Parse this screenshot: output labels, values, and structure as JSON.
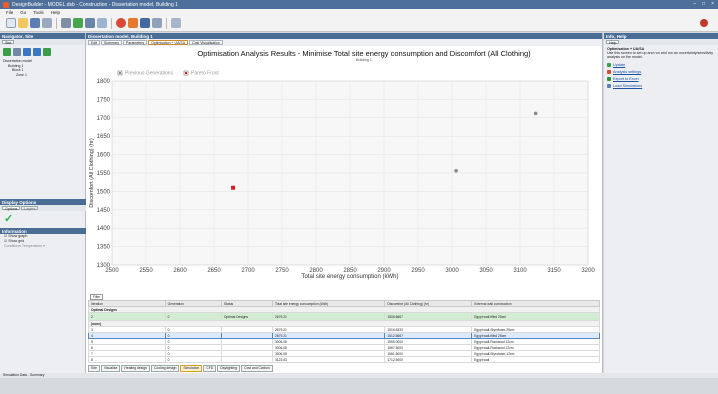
{
  "window": {
    "title": "DesignBuilder - MODEL.dsb - Construction - Dissertation model, Building 1",
    "controls": [
      "–",
      "□",
      "×"
    ]
  },
  "menu": [
    "File",
    "Go",
    "Tools",
    "Help"
  ],
  "left": {
    "header": "Navigator, Site",
    "tabs": [
      "Site"
    ],
    "tree": [
      "Dissertation model",
      "Building 1",
      "Block 1",
      "Zone 1"
    ],
    "display_header": "Display Options",
    "display_tabs": [
      "Options",
      "Layers"
    ],
    "checkbox_header": "Information",
    "checkboxes": [
      "Show graph",
      "Show grid",
      "Conditions  Temperature"
    ]
  },
  "main": {
    "header": "Dissertation model, Building 1",
    "tabs": [
      "Edit",
      "Summary",
      "Parameters",
      "Optimisation + UA/SA",
      "Cost Visualisation"
    ],
    "results_filter": "Filter",
    "grid_columns": [
      "Iteration",
      "Generation",
      "Status",
      "Total site energy consumption (kWh)",
      "Discomfort (All Clothing) (hr)",
      "External wall construction"
    ],
    "grid_groups": [
      "Optimal Designs",
      "(none)"
    ],
    "grid_rows": [
      {
        "it": "2",
        "gen": "0",
        "status": "Optimal Designs",
        "energy": "2679.21",
        "discomfort": "1506.6667",
        "wall": "Egypt wall-filled 25cm",
        "kind": "optimal"
      },
      {
        "it": "3",
        "gen": "0",
        "status": "",
        "energy": "2679.21",
        "discomfort": "1516.6333",
        "wall": "Egypt wall-Styrofoam 25cm",
        "kind": ""
      },
      {
        "it": "4",
        "gen": "0",
        "status": "",
        "energy": "2679.21",
        "discomfort": "1512.5667",
        "wall": "Egypt wall-filled 25cm",
        "kind": "sel"
      },
      {
        "it": "5",
        "gen": "0",
        "status": "",
        "energy": "3006.08",
        "discomfort": "1555.0000",
        "wall": "Egypt wall-Rockwool 12cm",
        "kind": ""
      },
      {
        "it": "6",
        "gen": "0",
        "status": "",
        "energy": "3006.08",
        "discomfort": "1567.5000",
        "wall": "Egypt wall-Rockwool 12cm",
        "kind": ""
      },
      {
        "it": "7",
        "gen": "0",
        "status": "",
        "energy": "3006.08",
        "discomfort": "1561.5000",
        "wall": "Egypt wall-Styrofoam 12cm",
        "kind": ""
      },
      {
        "it": "8",
        "gen": "0",
        "status": "",
        "energy": "3123.43",
        "discomfort": "1712.5000",
        "wall": "Egypt wall",
        "kind": ""
      }
    ],
    "bottom_tabs": [
      "Site",
      "Visualise",
      "Heating design",
      "Cooling design",
      "Simulation",
      "CFD",
      "Daylighting",
      "Cost and Carbon"
    ],
    "active_bottom_tab": "Simulation"
  },
  "right": {
    "header": "Info, Help",
    "tabs": [
      "Help"
    ],
    "info_title": "Optimisation + UA/SA",
    "info_text": "Use this screen to set up and run and run an uncertainty/sensitivity analysis on the model.",
    "links": [
      "Update",
      "Analysis settings",
      "Export to Excel",
      "Load Simulations"
    ]
  },
  "status": "Simulation Data - Summary",
  "colors": {
    "accent": "#4a6d95",
    "pareto": "#d21f1f",
    "generation": "#888888"
  },
  "chart_data": {
    "type": "scatter",
    "title": "Optimisation Analysis Results - Minimise Total site energy consumption and Discomfort (All Clothing)",
    "subtitle": "Building 1",
    "xlabel": "Total site energy consumption (kWh)",
    "ylabel": "Discomfort (All Clothing) (hr)",
    "xlim": [
      2500,
      3200
    ],
    "ylim": [
      1300,
      1800
    ],
    "xticks": [
      2500,
      2550,
      2600,
      2650,
      2700,
      2750,
      2800,
      2850,
      2900,
      2950,
      3000,
      3050,
      3100,
      3150,
      3200
    ],
    "yticks": [
      1300,
      1350,
      1400,
      1450,
      1500,
      1550,
      1600,
      1650,
      1700,
      1750,
      1800
    ],
    "legend": [
      "Previous Generations",
      "Pareto Front"
    ],
    "legend_position": "top-left",
    "grid": true,
    "series": [
      {
        "name": "Pareto Front",
        "color": "#d21f1f",
        "points": [
          [
            2678,
            1510
          ]
        ]
      },
      {
        "name": "Previous Generations",
        "color": "#888888",
        "points": [
          [
            3006,
            1556
          ],
          [
            3123,
            1712
          ]
        ]
      }
    ]
  }
}
